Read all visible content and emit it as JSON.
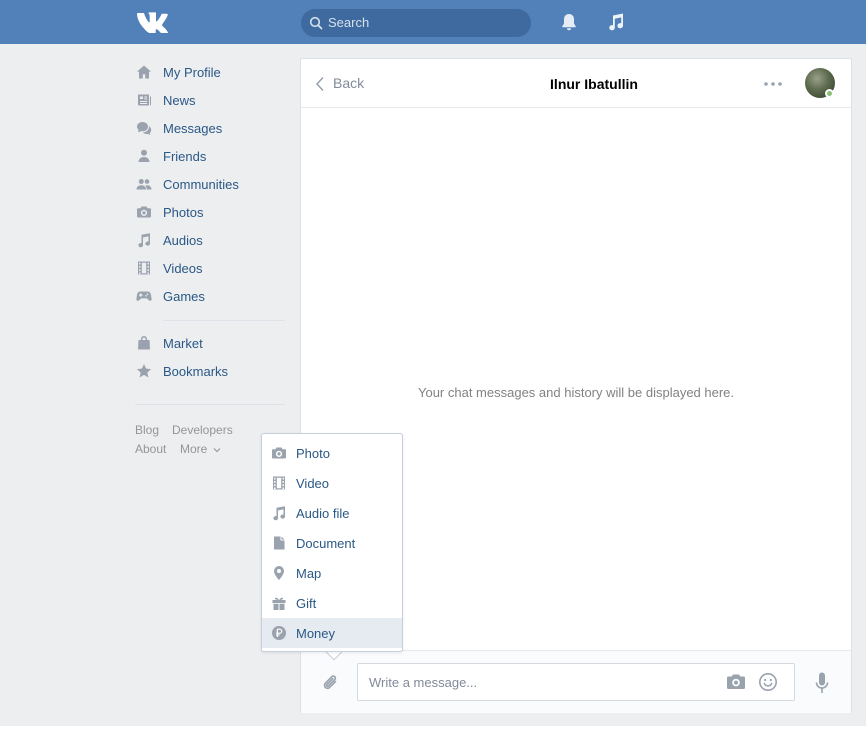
{
  "header": {
    "search_placeholder": "Search"
  },
  "sidebar": {
    "items": [
      {
        "label": "My Profile",
        "icon": "home-icon"
      },
      {
        "label": "News",
        "icon": "newspaper-icon"
      },
      {
        "label": "Messages",
        "icon": "chat-bubbles-icon"
      },
      {
        "label": "Friends",
        "icon": "person-icon"
      },
      {
        "label": "Communities",
        "icon": "people-icon"
      },
      {
        "label": "Photos",
        "icon": "camera-icon"
      },
      {
        "label": "Audios",
        "icon": "music-note-icon"
      },
      {
        "label": "Videos",
        "icon": "film-icon"
      },
      {
        "label": "Games",
        "icon": "gamepad-icon"
      }
    ],
    "items2": [
      {
        "label": "Market",
        "icon": "shopping-bag-icon"
      },
      {
        "label": "Bookmarks",
        "icon": "star-icon"
      }
    ],
    "footer": {
      "blog": "Blog",
      "developers": "Developers",
      "about": "About",
      "more": "More"
    }
  },
  "chat": {
    "back_label": "Back",
    "title": "Ilnur Ibatullin",
    "empty_text": "Your chat messages and history will be displayed here.",
    "input_placeholder": "Write a message..."
  },
  "attach_menu": {
    "items": [
      {
        "label": "Photo",
        "icon": "camera-icon"
      },
      {
        "label": "Video",
        "icon": "film-icon"
      },
      {
        "label": "Audio file",
        "icon": "music-note-icon"
      },
      {
        "label": "Document",
        "icon": "document-icon"
      },
      {
        "label": "Map",
        "icon": "map-pin-icon"
      },
      {
        "label": "Gift",
        "icon": "gift-icon"
      },
      {
        "label": "Money",
        "icon": "ruble-coin-icon"
      }
    ],
    "selected": "Money"
  },
  "colors": {
    "header": "#5181b8",
    "link": "#2a5885",
    "icon": "#99a2ad",
    "background": "#edeef0"
  }
}
